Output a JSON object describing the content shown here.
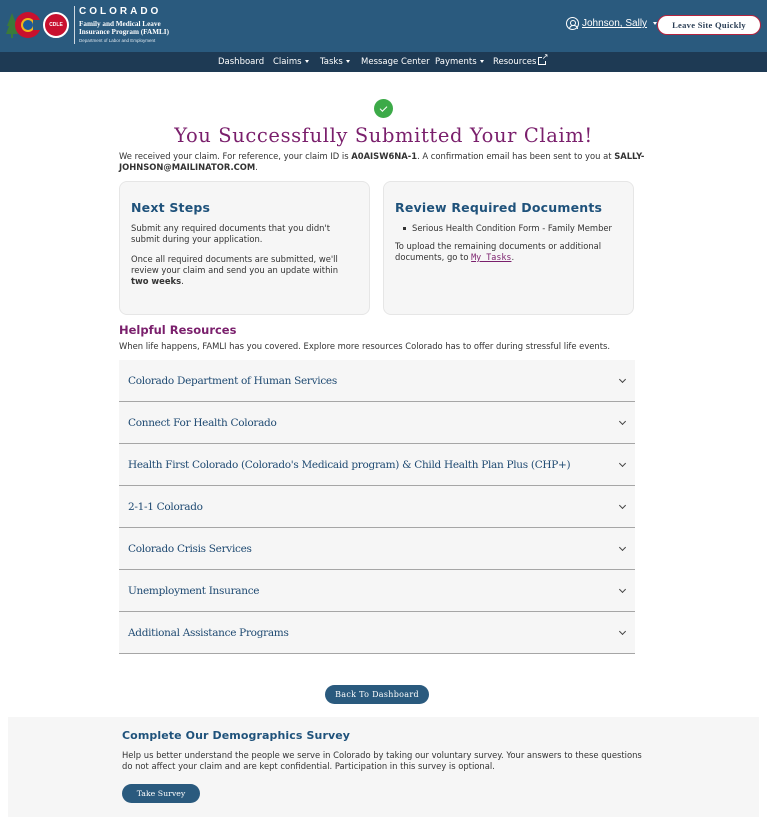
{
  "header": {
    "logo": {
      "state": "COLORADO",
      "program_line1": "Family and Medical Leave",
      "program_line2": "Insurance Program (FAMLI)",
      "department": "Department of Labor and Employment",
      "badge": "CDLE"
    },
    "user_name": "Johnson, Sally",
    "leave_site_label": "Leave Site Quickly"
  },
  "nav": {
    "items": [
      {
        "label": "Dashboard",
        "has_dropdown": false
      },
      {
        "label": "Claims",
        "has_dropdown": true
      },
      {
        "label": "Tasks",
        "has_dropdown": true
      },
      {
        "label": "Message Center",
        "has_dropdown": false
      },
      {
        "label": "Payments",
        "has_dropdown": true
      },
      {
        "label": "Resources",
        "external": true
      }
    ]
  },
  "success": {
    "title": "You Successfully Submitted Your Claim!",
    "text_before_id": "We received your claim. For reference, your claim ID is ",
    "claim_id": "A0AISW6NA-1",
    "text_after_id": ". A confirmation email has been sent to you at ",
    "email": "SALLY-JOHNSON@MAILINATOR.COM",
    "text_end": "."
  },
  "next_steps": {
    "title": "Next Steps",
    "para1": "Submit any required documents that you didn't submit during your application.",
    "para2_before": "Once all required documents are submitted, we'll review your claim and send you an update within ",
    "para2_bold": "two weeks",
    "para2_end": "."
  },
  "review_docs": {
    "title": "Review Required Documents",
    "documents": [
      "Serious Health Condition Form - Family Member"
    ],
    "upload_text": "To upload the remaining documents or additional documents, go to ",
    "tasks_link": "My Tasks",
    "upload_end": "."
  },
  "resources": {
    "title": "Helpful Resources",
    "subtitle": "When life happens, FAMLI has you covered. Explore more resources Colorado has to offer during stressful life events.",
    "items": [
      "Colorado Department of Human Services",
      "Connect For Health Colorado",
      "Health First Colorado (Colorado's Medicaid program) & Child Health Plan Plus (CHP+)",
      "2-1-1 Colorado",
      "Colorado Crisis Services",
      "Unemployment Insurance",
      "Additional Assistance Programs"
    ]
  },
  "back_button_label": "Back To Dashboard",
  "survey": {
    "title": "Complete Our Demographics Survey",
    "text": "Help us better understand the people we serve in Colorado by taking our voluntary survey. Your answers to these questions do not affect your claim and are kept confidential. Participation in this survey is optional.",
    "button_label": "Take Survey"
  },
  "colors": {
    "header_bg": "#2a5a7e",
    "nav_bg": "#1e3a54",
    "accent_purple": "#7a1f6c",
    "heading_blue": "#1f527b",
    "success_green": "#3caa48"
  }
}
